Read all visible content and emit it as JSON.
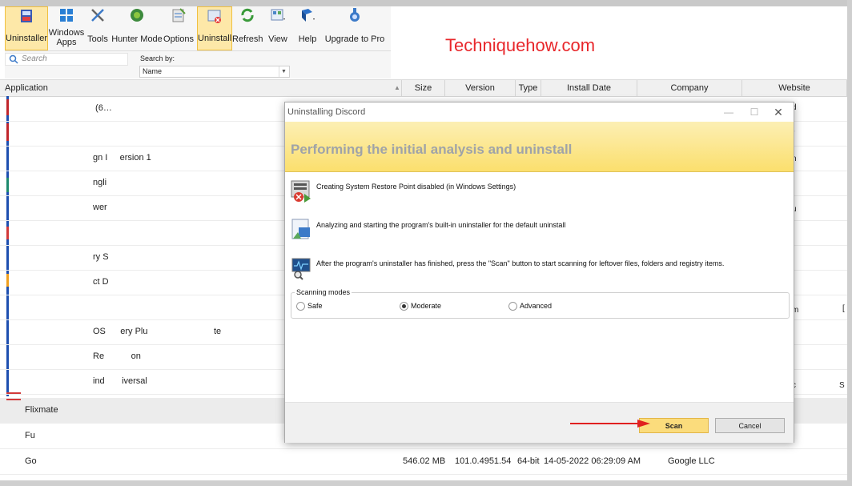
{
  "watermark": "Techniquehow.com",
  "ribbon": {
    "uninstaller": "Uninstaller",
    "windows_apps_1": "Windows",
    "windows_apps_2": "Apps",
    "tools": "Tools",
    "hunter_mode": "Hunter Mode",
    "options": "Options",
    "uninstall": "Uninstall",
    "refresh": "Refresh",
    "view": "View",
    "help": "Help",
    "upgrade": "Upgrade to Pro"
  },
  "search": {
    "placeholder": "Search",
    "search_by_label": "Search by:",
    "search_by_value": "Name"
  },
  "columns": {
    "application": "Application",
    "size": "Size",
    "version": "Version",
    "type": "Type",
    "install_date": "Install Date",
    "company": "Company",
    "website": "Website"
  },
  "rows": [
    {
      "name": "",
      "frag": " (6…"
    },
    {
      "name": "",
      "frag": ""
    },
    {
      "name": "",
      "frag": "gn I     ersion 1"
    },
    {
      "name": "",
      "frag": "ngli"
    },
    {
      "name": "",
      "frag": "wer"
    },
    {
      "name": "",
      "frag": ""
    },
    {
      "name": "",
      "frag": "ry S"
    },
    {
      "name": "",
      "frag": "ct D"
    },
    {
      "name": "",
      "frag": ""
    },
    {
      "name": "",
      "frag": "OS      ery Plu                           te"
    },
    {
      "name": "",
      "frag": "Re           on"
    },
    {
      "name": "",
      "frag": "ind       iversal"
    },
    {
      "name": "Flixmate",
      "frag": ""
    },
    {
      "name": "Fu",
      "frag": ""
    },
    {
      "name": "Go",
      "frag": ""
    }
  ],
  "google_row": {
    "size": "546.02 MB",
    "version": "101.0.4951.54",
    "type": "64-bit",
    "date": "14-05-2022 06:29:09 AM",
    "company": "Google LLC"
  },
  "dialog": {
    "title": "Uninstalling Discord",
    "heading": "Performing the initial analysis and uninstall",
    "step1": "Creating System Restore Point disabled (in Windows Settings)",
    "step2": "Analyzing and starting the program's built-in uninstaller for the default uninstall",
    "step3": "After the program's uninstaller has finished, press the \"Scan\" button to start scanning for leftover files, folders and registry items.",
    "modes_label": "Scanning modes",
    "mode_safe": "Safe",
    "mode_moderate": "Moderate",
    "mode_advanced": "Advanced",
    "selected_mode": "Moderate",
    "scan": "Scan",
    "cancel": "Cancel"
  },
  "colors": {
    "accent_yellow": "#fbdc7c",
    "banner": "#fbdf6d",
    "heading_grey": "#9fa3a8",
    "watermark_red": "#e8272b",
    "arrow_red": "#e02020"
  }
}
